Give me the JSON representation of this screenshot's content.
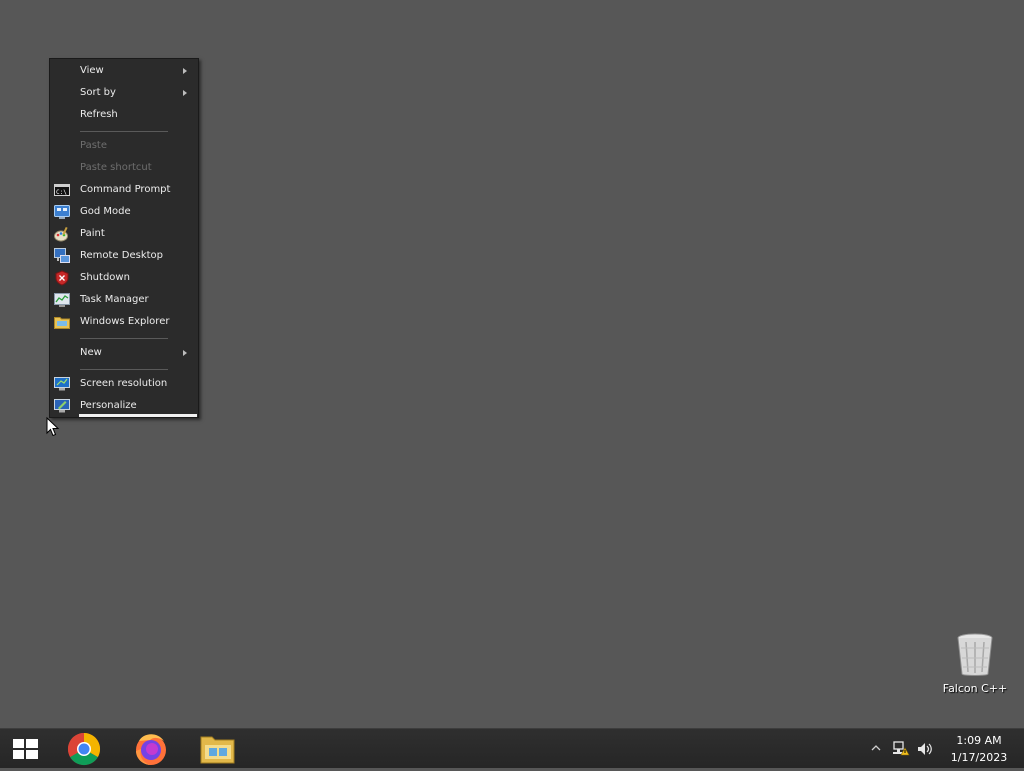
{
  "context_menu": {
    "items": [
      {
        "label": "View",
        "submenu": true,
        "disabled": false
      },
      {
        "label": "Sort by",
        "submenu": true,
        "disabled": false
      },
      {
        "label": "Refresh",
        "submenu": false,
        "disabled": false
      },
      {
        "label": "Paste",
        "submenu": false,
        "disabled": true
      },
      {
        "label": "Paste shortcut",
        "submenu": false,
        "disabled": true
      },
      {
        "label": "Command Prompt",
        "icon": "command-prompt-icon"
      },
      {
        "label": "God Mode",
        "icon": "god-mode-icon"
      },
      {
        "label": "Paint",
        "icon": "paint-icon"
      },
      {
        "label": "Remote Desktop",
        "icon": "remote-desktop-icon"
      },
      {
        "label": "Shutdown",
        "icon": "shutdown-icon"
      },
      {
        "label": "Task Manager",
        "icon": "task-manager-icon"
      },
      {
        "label": "Windows Explorer",
        "icon": "windows-explorer-icon"
      },
      {
        "label": "New",
        "submenu": true
      },
      {
        "label": "Screen resolution",
        "icon": "screen-resolution-icon"
      },
      {
        "label": "Personalize",
        "icon": "personalize-icon"
      }
    ]
  },
  "desktop": {
    "icons": [
      {
        "label": "Falcon C++",
        "icon": "recycle-bin-icon"
      }
    ]
  },
  "taskbar": {
    "pinned": [
      {
        "name": "start",
        "icon": "windows-logo-icon"
      },
      {
        "name": "chrome",
        "icon": "chrome-icon"
      },
      {
        "name": "firefox",
        "icon": "firefox-icon"
      },
      {
        "name": "explorer",
        "icon": "folder-icon"
      }
    ],
    "tray": {
      "icons": [
        "show-hidden-icons-arrow",
        "network-icon",
        "volume-icon"
      ],
      "time": "1:09 AM",
      "date": "1/17/2023"
    }
  },
  "colors": {
    "desktop_bg": "#575757",
    "menu_bg": "#2b2b2b",
    "taskbar_bg": "#2a2a2a"
  }
}
